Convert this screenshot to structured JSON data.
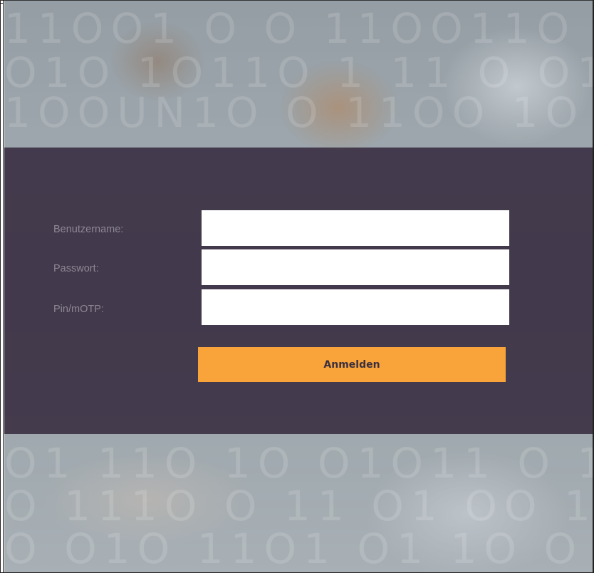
{
  "form": {
    "username_label": "Benutzername:",
    "username_value": "",
    "password_label": "Passwort:",
    "password_value": "",
    "pin_label": "Pin/mOTP:",
    "pin_value": "",
    "submit_label": "Anmelden"
  },
  "colors": {
    "band": "#3a3042",
    "button": "#f9a43a",
    "button_text": "#3a2f3f",
    "label_text": "#8d8794"
  }
}
